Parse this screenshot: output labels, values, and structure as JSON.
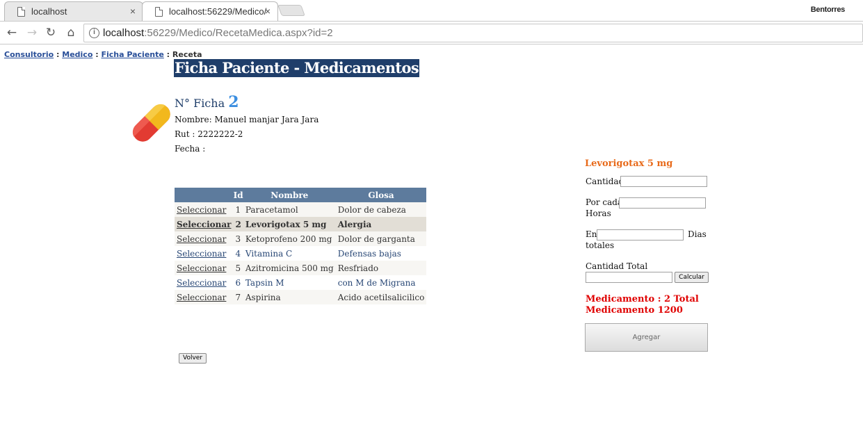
{
  "browser": {
    "tabs": [
      {
        "title": "localhost",
        "close": "×"
      },
      {
        "title": "localhost:56229/Medico/",
        "close": "×"
      }
    ],
    "profile_name": "Bentorres",
    "address": {
      "host": "localhost",
      "path": ":56229/Medico/RecetaMedica.aspx?id=2"
    },
    "icons": {
      "back": "←",
      "forward": "→",
      "reload": "↻",
      "home": "⌂",
      "info": "i"
    }
  },
  "breadcrumb": {
    "items": [
      "Consultorio",
      "Medico",
      "Ficha Paciente"
    ],
    "separator": " : ",
    "current": "Receta"
  },
  "page_title": "Ficha Paciente - Medicamentos",
  "patient": {
    "ficha_label": "N° Ficha ",
    "ficha_number": "2",
    "nombre": "Nombre:  Manuel manjar Jara Jara",
    "rut": "Rut : 2222222-2",
    "fecha": "Fecha :"
  },
  "grid": {
    "columns": [
      "",
      "Id",
      "Nombre",
      "Glosa"
    ],
    "select_label": "Seleccionar",
    "rows": [
      {
        "id": "1",
        "nombre": "Paracetamol",
        "glosa": "Dolor de cabeza"
      },
      {
        "id": "2",
        "nombre": "Levorigotax 5 mg",
        "glosa": "Alergia"
      },
      {
        "id": "3",
        "nombre": "Ketoprofeno 200 mg",
        "glosa": "Dolor de garganta"
      },
      {
        "id": "4",
        "nombre": "Vitamina C",
        "glosa": "Defensas bajas"
      },
      {
        "id": "5",
        "nombre": "Azitromicina 500 mg",
        "glosa": "Resfriado"
      },
      {
        "id": "6",
        "nombre": "Tapsin M",
        "glosa": "con M de Migrana"
      },
      {
        "id": "7",
        "nombre": "Aspirina",
        "glosa": "Acido acetilsalicilico"
      }
    ],
    "selected_id": "2"
  },
  "volver_label": "Volver",
  "form": {
    "medicamento": "Levorigotax 5 mg",
    "cantidad_label": "Cantidad:",
    "cantidad_value": "",
    "por_cada_label": "Por cada :",
    "por_cada_value": "",
    "horas_label": "Horas",
    "en_label": "En",
    "en_value": "",
    "dias_label": "Dias",
    "totales_label": "totales",
    "cantidad_total_label": "Cantidad Total",
    "cantidad_total_value": "",
    "calcular_label": "Calcular",
    "resultado": "Medicamento : 2 Total Medicamento 1200",
    "agregar_label": "Agregar"
  },
  "colors": {
    "title_bg": "#1f3e6a",
    "grid_header": "#5d7b9d",
    "ficha_number": "#3b8ee0",
    "med_name": "#e86a1a",
    "resultado": "#e00000"
  }
}
